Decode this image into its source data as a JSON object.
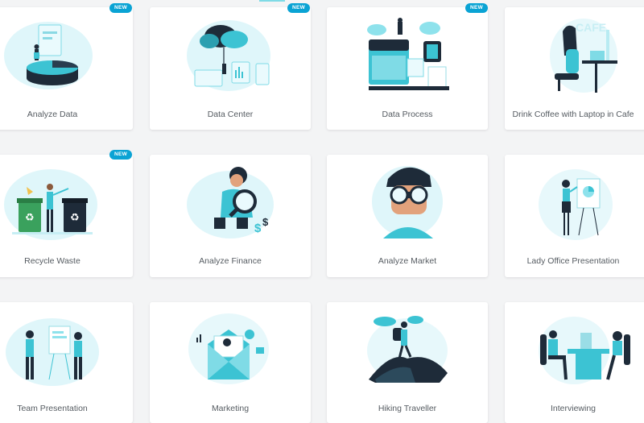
{
  "cards": [
    {
      "title": "Analyze Data",
      "badge": "NEW"
    },
    {
      "title": "Data Center",
      "badge": "NEW"
    },
    {
      "title": "Data Process",
      "badge": "NEW"
    },
    {
      "title": "Drink Coffee with Laptop in Cafe",
      "badge": ""
    },
    {
      "title": "Recycle Waste",
      "badge": "NEW"
    },
    {
      "title": "Analyze Finance",
      "badge": ""
    },
    {
      "title": "Analyze Market",
      "badge": ""
    },
    {
      "title": "Lady Office Presentation",
      "badge": ""
    },
    {
      "title": "Team Presentation",
      "badge": ""
    },
    {
      "title": "Marketing",
      "badge": ""
    },
    {
      "title": "Hiking Traveller",
      "badge": ""
    },
    {
      "title": "Interviewing",
      "badge": ""
    }
  ],
  "colors": {
    "accent": "#0aa3d4",
    "teal": "#3cc3d3",
    "dark": "#1e2b39",
    "blob": "#dff6fa"
  }
}
